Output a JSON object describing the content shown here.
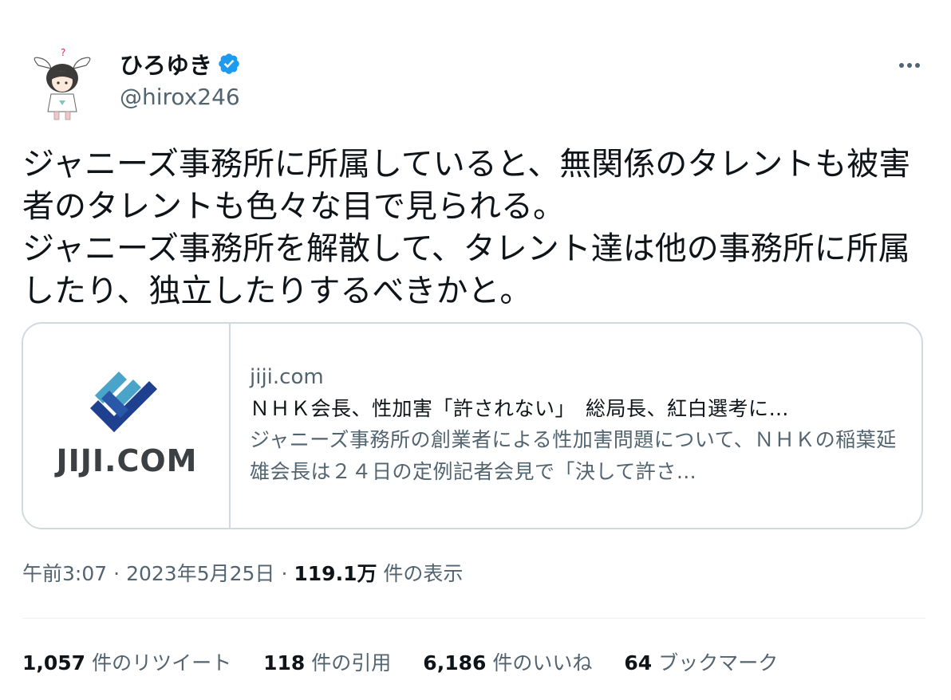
{
  "user": {
    "display_name": "ひろゆき",
    "handle": "@hirox246",
    "verified": true,
    "avatar_icon": "anime-bunny-ear-character-avatar"
  },
  "tweet": {
    "text": "ジャニーズ事務所に所属していると、無関係のタレントも被害者のタレントも色々な目で見られる。\nジャニーズ事務所を解散して、タレント達は他の事務所に所属したり、独立したりするべきかと。"
  },
  "card": {
    "logo_text": "JIJI.COM",
    "domain": "jiji.com",
    "title": "ＮＨＫ会長、性加害「許されない」　総局長、紅白選考に…",
    "description": "ジャニーズ事務所の創業者による性加害問題について、ＮＨＫの稲葉延雄会長は２４日の定例記者会見で「決して許さ…"
  },
  "meta": {
    "time": "午前3:07",
    "separator": "·",
    "date": "2023年5月25日",
    "views": "119.1万",
    "views_label": "件の表示"
  },
  "stats": [
    {
      "count": "1,057",
      "label": "件のリツイート"
    },
    {
      "count": "118",
      "label": "件の引用"
    },
    {
      "count": "6,186",
      "label": "件のいいね"
    },
    {
      "count": "64",
      "label": "ブックマーク"
    }
  ],
  "colors": {
    "verified_blue": "#1d9bf0",
    "secondary_text": "#536471",
    "primary_text": "#0f1419",
    "logo_light_blue": "#4aa3c9",
    "logo_dark_blue": "#1f3f8f"
  },
  "icons": {
    "more": "more-horizontal-icon",
    "verified": "verified-badge-icon"
  }
}
